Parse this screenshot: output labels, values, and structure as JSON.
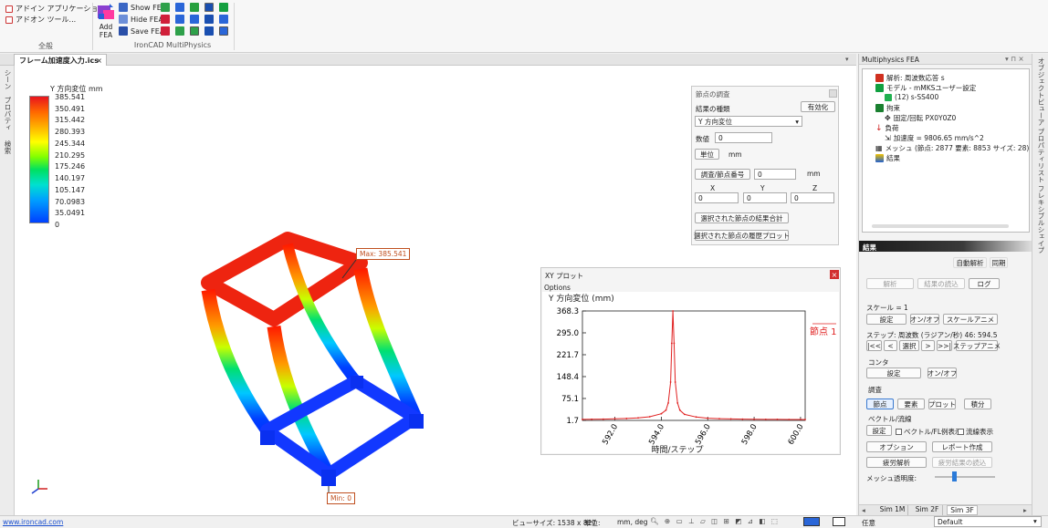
{
  "ribbon": {
    "addin_app_label": "アドイン アプリケーション...",
    "addin_tools_label": "アドオン ツール...",
    "group_general": "全般",
    "add_fea_label1": "Add",
    "add_fea_label2": "FEA",
    "show_fea_label": "Show FEA",
    "hide_fea_label": "Hide FEA",
    "save_fea_label": "Save FEA",
    "group_multiphysics": "IronCAD MultiPhysics"
  },
  "document": {
    "tab_label": "フレーム加速度入力.ics",
    "close_glyph": "×"
  },
  "left_strip": {
    "scene_label": "シーン",
    "property_label": "プロパティ",
    "search_label": "検索"
  },
  "legend": {
    "title": "Y 方向変位 mm",
    "values": [
      "385.541",
      "350.491",
      "315.442",
      "280.393",
      "245.344",
      "210.295",
      "175.246",
      "140.197",
      "105.147",
      "70.0983",
      "35.0491",
      "0"
    ]
  },
  "model": {
    "max_label": "Max: 385.541",
    "min_label": "Min: 0"
  },
  "node_panel": {
    "title": "節点の調査",
    "result_type_label": "結果の種類",
    "enable_button": "有効化",
    "result_type_value": "Y 方向変位",
    "value_label": "数値",
    "value": "0",
    "unit_button": "単位",
    "unit_value": "mm",
    "probe_node_button": "調査/節点番号",
    "probe_node_value": "0",
    "probe_unit": "mm",
    "x_header": "X",
    "y_header": "Y",
    "z_header": "Z",
    "x_value": "0",
    "y_value": "0",
    "z_value": "0",
    "sum_button": "選択された節点の結果合計",
    "history_button": "選択された節点の履歴プロット"
  },
  "xy_plot": {
    "title": "XY プロット",
    "options_label": "Options",
    "close_glyph": "×"
  },
  "chart_data": {
    "type": "line",
    "title": "Y 方向変位 (mm)",
    "xlabel": "時間/ステップ",
    "ylabel": "",
    "xlim": [
      590.6,
      600.2
    ],
    "ylim": [
      1.7,
      368.3
    ],
    "x_ticks": [
      "592.0",
      "594.0",
      "596.0",
      "598.0",
      "600.0"
    ],
    "y_ticks": [
      "368.3",
      "295.0",
      "221.7",
      "148.4",
      "75.1",
      "1.7"
    ],
    "legend_position": "right",
    "series": [
      {
        "name": "節点 1",
        "color": "#e02020",
        "x": [
          590.6,
          591.0,
          591.5,
          592.0,
          592.5,
          593.0,
          593.5,
          594.0,
          594.2,
          594.3,
          594.4,
          594.45,
          594.5,
          594.55,
          594.6,
          594.7,
          594.8,
          595.0,
          595.5,
          596.0,
          596.5,
          597.0,
          597.5,
          598.0,
          598.5,
          599.0,
          599.5,
          600.0,
          600.2
        ],
        "y": [
          5,
          5.5,
          6,
          7,
          8,
          10,
          14,
          24,
          36,
          60,
          130,
          260,
          368.3,
          260,
          130,
          60,
          36,
          22,
          13,
          9,
          7.5,
          6.5,
          6,
          5.5,
          5.2,
          5,
          4.8,
          4.7,
          4.6
        ]
      }
    ]
  },
  "right_panel": {
    "header_title": "Multiphysics FEA",
    "tree": {
      "analysis": "解析: 周波数応答 s",
      "model": "モデル - mMKSユーザー設定",
      "part": "(12) s-SS400",
      "constraint": "拘束",
      "fixed": "固定/回転 PX0Y0Z0",
      "load": "負荷",
      "accel": "加速度 = 9806.65 mm/s^2",
      "mesh": "メッシュ (節点: 2877  要素: 8853  サイズ: 28) mm",
      "results": "結果"
    },
    "results_header": "結果",
    "auto_analysis": "自動解析",
    "sync": "同期",
    "analyze": "解析",
    "read_results": "結果の読込",
    "log": "ログ",
    "scale_label": "スケール = 1",
    "scale_set": "設定",
    "scale_toggle": "オン/オフ",
    "scale_anim": "スケールアニメ",
    "step_label": "ステップ: 周波数 (ラジアン/秒) 46: 594.5",
    "step_first": "|<<",
    "step_prev": "<",
    "step_select": "選択",
    "step_next": ">",
    "step_last": ">>|",
    "step_anim": "ステップアニメ",
    "contour_label": "コンタ",
    "contour_set": "設定",
    "contour_toggle": "オン/オフ",
    "probe_label": "調査",
    "probe_node": "節点",
    "probe_element": "要素",
    "probe_plot": "プロット",
    "probe_integral": "積分",
    "vector_label": "ベクトル/流線",
    "vector_set": "設定",
    "vector_check": "ベクトル/FL例表示",
    "stream_check": "流線表示",
    "options": "オプション",
    "report": "レポート作成",
    "fatigue": "疲労解析",
    "fatigue_read": "疲労結果の読込",
    "mesh_transparency": "メッシュ透明度:",
    "tabs": [
      "Sim 1M",
      "Sim 2F",
      "Sim 3F"
    ]
  },
  "right_strip": {
    "label": "オブジェクトビューア  プロパティリスト  フレキシブルシェイプ"
  },
  "status": {
    "link": "www.ironcad.com",
    "view_size": "ビューサイズ: 1538 x  827",
    "units": "単位:",
    "units_value": "mm, deg",
    "mode": "任意",
    "default": "Default"
  }
}
